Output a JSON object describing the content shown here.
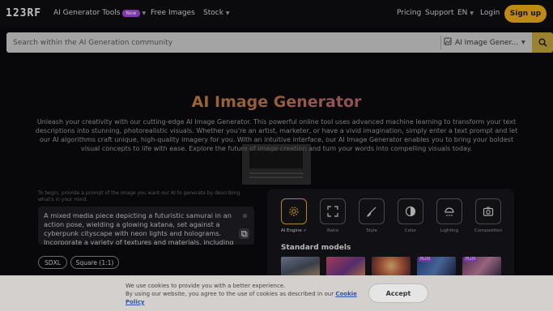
{
  "header": {
    "logo": "123RF",
    "nav": [
      {
        "label": "AI Generator Tools",
        "badge": "New"
      },
      {
        "label": "Free Images"
      },
      {
        "label": "Stock"
      }
    ],
    "pricing": "Pricing",
    "support": "Support",
    "language": "EN",
    "login": "Login",
    "signup": "Sign up"
  },
  "search": {
    "placeholder": "Search within the AI Generation community",
    "scope": "AI Image Gener..."
  },
  "hero": {
    "title": "AI Image Generator",
    "description": "Unleash your creativity with our cutting-edge AI Image Generator. This powerful online tool uses advanced machine learning to transform your text descriptions into stunning, photorealistic visuals. Whether you're an artist, marketer, or have a vivid imagination, simply enter a text prompt and let our AI algorithms craft unique, high-quality imagery for you. With an intuitive interface, our AI Image Generator enables you to bring your boldest visual concepts to life with ease. Explore the future of image creation and turn your words into compelling visuals today."
  },
  "prompt": {
    "hint": "To begin, provide a prompt of the image you want our AI to generate by describing what's in your mind.",
    "text": "A mixed media piece depicting a futuristic samurai in an action pose, wielding a glowing katana, set against a cyberpunk cityscape with neon lights and holograms. Incorporate a variety of textures and materials, including",
    "chips": [
      "SDXL",
      "Square (1:1)"
    ]
  },
  "tools": [
    {
      "label": "AI Engine ✓",
      "icon": "gear-icon"
    },
    {
      "label": "Ratio",
      "icon": "expand-icon"
    },
    {
      "label": "Style",
      "icon": "brush-icon"
    },
    {
      "label": "Color",
      "icon": "contrast-icon"
    },
    {
      "label": "Lighting",
      "icon": "lamp-icon"
    },
    {
      "label": "Composition",
      "icon": "camera-icon"
    }
  ],
  "models": {
    "title": "Standard models",
    "plus_label": "PLUS"
  },
  "cookie": {
    "line1": "We use cookies to provide you with a better experience.",
    "line2": "By using our website, you agree to the use of cookies as described in our",
    "link": "Cookie Policy",
    "accept": "Accept"
  }
}
